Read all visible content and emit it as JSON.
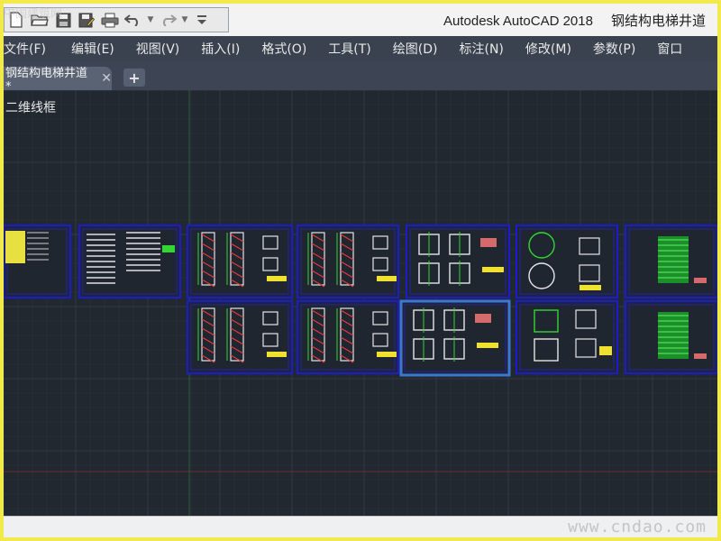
{
  "titlebar": {
    "app_title": "Autodesk AutoCAD 2018",
    "document_title": "钢结构电梯井道",
    "watermark_corner": "中国建筑网"
  },
  "quick_access": [
    {
      "name": "new-file-icon"
    },
    {
      "name": "open-file-icon"
    },
    {
      "name": "save-icon"
    },
    {
      "name": "save-as-icon"
    },
    {
      "name": "print-icon"
    },
    {
      "name": "undo-icon"
    },
    {
      "name": "redo-icon"
    },
    {
      "name": "customize-dropdown-icon"
    }
  ],
  "menu": {
    "file": "文件(F)",
    "edit": "编辑(E)",
    "view": "视图(V)",
    "insert": "插入(I)",
    "format": "格式(O)",
    "tools": "工具(T)",
    "draw": "绘图(D)",
    "dimension": "标注(N)",
    "modify": "修改(M)",
    "parameters": "参数(P)",
    "window": "窗口"
  },
  "tabs": {
    "active_tab": "钢结构电梯井道*",
    "close_symbol": "✕",
    "new_tab_symbol": "+"
  },
  "viewport": {
    "visual_style": "二维线框"
  },
  "status": {
    "watermark": "www.cndao.com"
  },
  "colors": {
    "accent_border": "#f2e94a",
    "canvas_background": "#212830",
    "sheet_frame": "#1b1bd6",
    "selected_sheet": "#3a78d4",
    "drawing_green": "#33d633",
    "drawing_red": "#e03a3a",
    "drawing_yellow": "#f0e030"
  }
}
